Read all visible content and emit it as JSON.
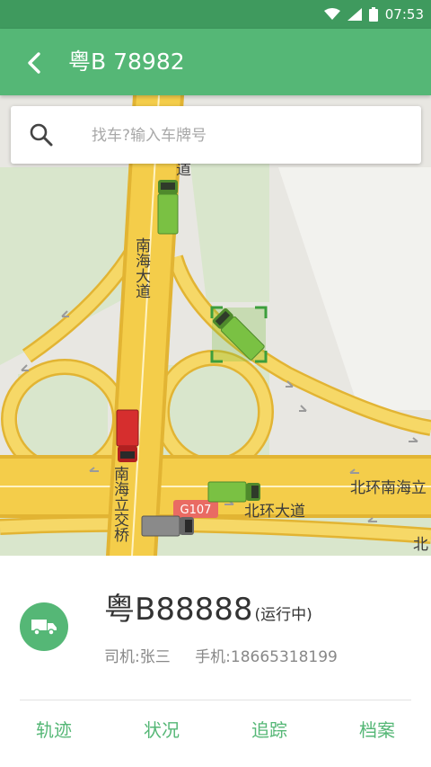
{
  "status_bar": {
    "time": "07:53",
    "icons": [
      "wifi-icon",
      "cellular-signal-icon",
      "battery-icon"
    ]
  },
  "app_bar": {
    "back_icon": "chevron-left-icon",
    "title": "粤B 78982"
  },
  "search": {
    "icon": "search-icon",
    "placeholder": "找车?输入车牌号",
    "value": ""
  },
  "map": {
    "road_labels": {
      "nanhai_avenue": "南海大道",
      "nanhai_avenue_top_fragment": "道",
      "nanhai_overpass": "南海立交桥",
      "beihuan_south": "北环南海立",
      "beihuan_avenue": "北环大道",
      "right_edge_fragment": "北",
      "highway_shield": "G107"
    },
    "vehicles": [
      {
        "name": "vehicle-green-1",
        "color": "#7ac143"
      },
      {
        "name": "vehicle-green-selected",
        "color": "#7ac143"
      },
      {
        "name": "vehicle-red",
        "color": "#d62e2e"
      },
      {
        "name": "vehicle-green-2",
        "color": "#7ac143"
      },
      {
        "name": "vehicle-gray",
        "color": "#8a8a8a"
      }
    ]
  },
  "vehicle_card": {
    "avatar_icon": "truck-icon",
    "plate": "粤B88888",
    "status": "(运行中)",
    "driver_label": "司机:",
    "driver_name": "张三",
    "phone_label": "手机:",
    "phone": "18665318199"
  },
  "actions": [
    {
      "label": "轨迹"
    },
    {
      "label": "状况"
    },
    {
      "label": "追踪"
    },
    {
      "label": "档案"
    }
  ],
  "colors": {
    "status_bar": "#3f9a5e",
    "app_bar": "#55b776",
    "accent": "#55b776",
    "road": "#f4cd4a",
    "road_edge": "#e2b433",
    "map_land": "#e8e7e2",
    "map_green": "#d9e6cc"
  }
}
